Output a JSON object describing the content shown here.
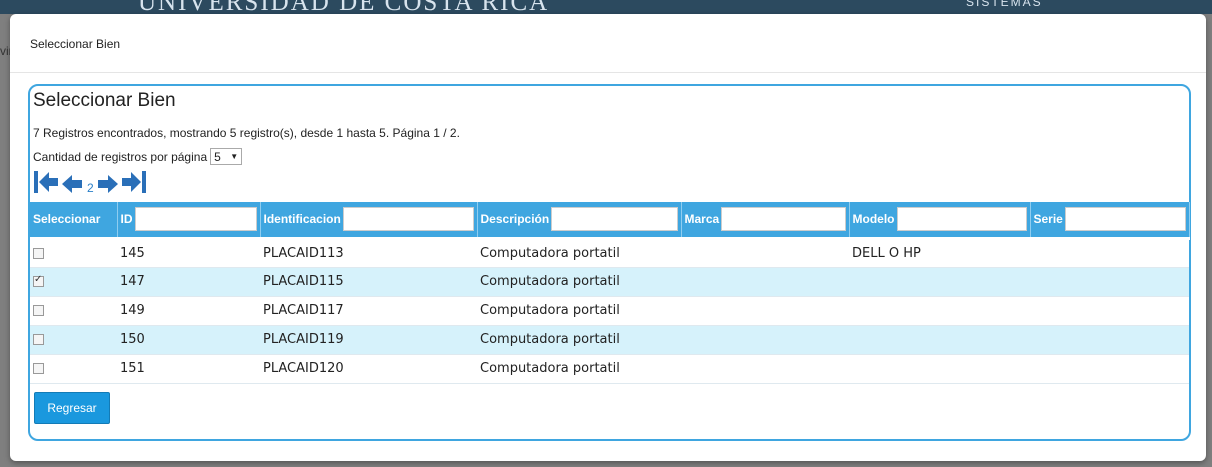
{
  "background": {
    "header_title": "UNIVERSIDAD DE COSTA RICA",
    "header_sub": "SISTEMAS",
    "left_text": "vin"
  },
  "modal": {
    "title": "Seleccionar Bien"
  },
  "panel": {
    "title": "Seleccionar Bien",
    "summary": "7 Registros encontrados, mostrando 5 registro(s), desde 1 hasta 5. Página 1 / 2.",
    "per_page_label": "Cantidad de registros por página",
    "per_page_value": "5",
    "pager": {
      "page_link": "2"
    }
  },
  "table": {
    "columns": [
      {
        "label": "Seleccionar",
        "filter": false
      },
      {
        "label": "ID",
        "filter": true
      },
      {
        "label": "Identificacion",
        "filter": true
      },
      {
        "label": "Descripción",
        "filter": true
      },
      {
        "label": "Marca",
        "filter": true
      },
      {
        "label": "Modelo",
        "filter": true
      },
      {
        "label": "Serie",
        "filter": true
      }
    ],
    "rows": [
      {
        "checked": false,
        "id": "145",
        "identificacion": "PLACAID113",
        "descripcion": "Computadora portatil",
        "marca": "",
        "modelo": "DELL O HP",
        "serie": ""
      },
      {
        "checked": true,
        "id": "147",
        "identificacion": "PLACAID115",
        "descripcion": "Computadora portatil",
        "marca": "",
        "modelo": "",
        "serie": ""
      },
      {
        "checked": false,
        "id": "149",
        "identificacion": "PLACAID117",
        "descripcion": "Computadora portatil",
        "marca": "",
        "modelo": "",
        "serie": ""
      },
      {
        "checked": false,
        "id": "150",
        "identificacion": "PLACAID119",
        "descripcion": "Computadora portatil",
        "marca": "",
        "modelo": "",
        "serie": ""
      },
      {
        "checked": false,
        "id": "151",
        "identificacion": "PLACAID120",
        "descripcion": "Computadora portatil",
        "marca": "",
        "modelo": "",
        "serie": ""
      }
    ]
  },
  "buttons": {
    "back": "Regresar"
  },
  "colors": {
    "accent": "#3fa6e0",
    "row_alt": "#d6f2fb",
    "button": "#1a98de"
  }
}
